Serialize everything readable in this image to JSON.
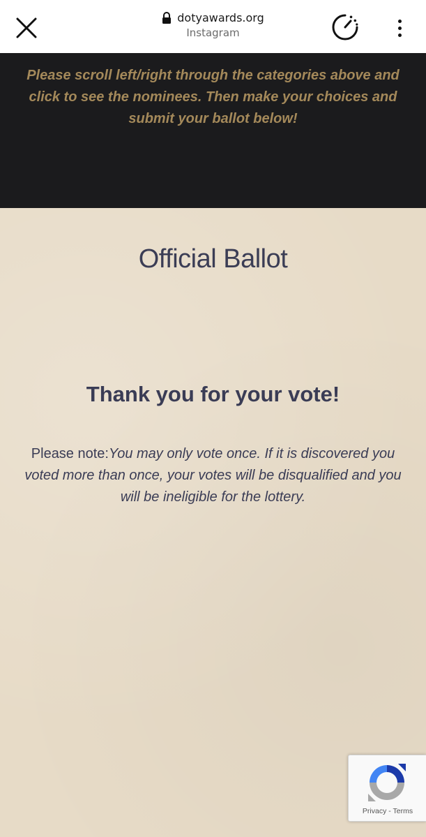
{
  "browser": {
    "url": "dotyawards.org",
    "source_app": "Instagram"
  },
  "banner": {
    "instructions": "Please scroll left/right through the categories above and click to see the nominees. Then make your choices and submit your ballot below!"
  },
  "ballot": {
    "title": "Official Ballot",
    "confirmation": "Thank you for your vote!",
    "note_label": "Please note:",
    "note_body": "You may only vote once. If it is discovered you voted more than once, your votes will be disqualified and you will be ineligible for the lottery."
  },
  "recaptcha": {
    "privacy": "Privacy",
    "separator": " - ",
    "terms": "Terms"
  },
  "colors": {
    "banner_text": "#a4895a",
    "ballot_bg": "#e7dbc7",
    "ballot_text": "#3a3c55",
    "dark_band": "#1b1b1d"
  },
  "icons": {
    "close": "close-icon",
    "lock": "lock-icon",
    "speed": "timer-speed-icon",
    "menu": "more-vert-icon",
    "recaptcha": "recaptcha-logo-icon"
  }
}
